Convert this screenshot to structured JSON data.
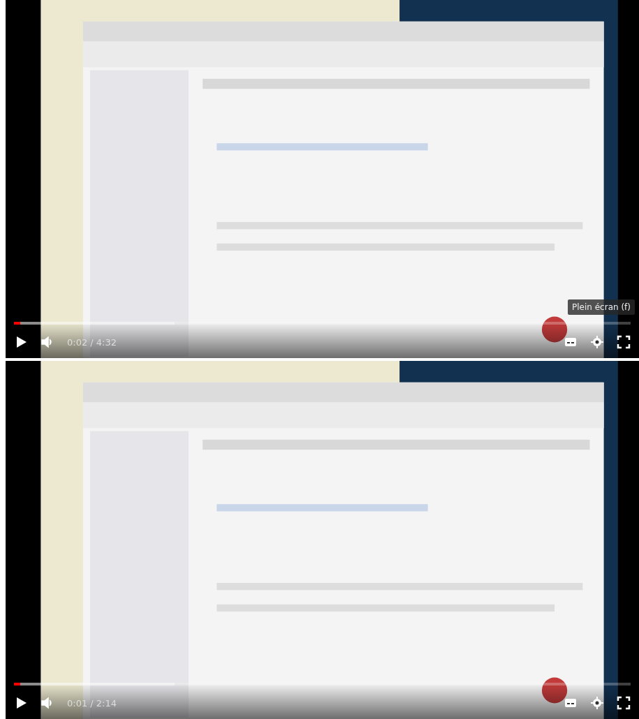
{
  "players": [
    {
      "time": "0:02 / 4:32",
      "progress": {
        "level": 0.01
      },
      "tooltip": "Plein écran (f)"
    },
    {
      "time": "0:01 / 2:14",
      "progress": {
        "level": 0.01
      }
    }
  ]
}
